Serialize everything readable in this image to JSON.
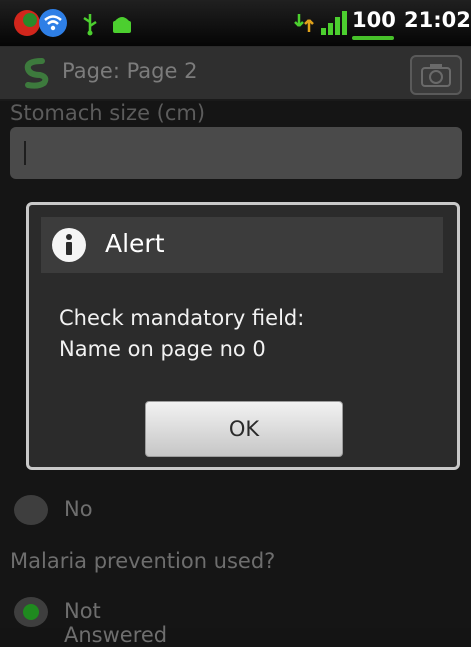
{
  "status_bar": {
    "battery": "100",
    "time": "21:02",
    "icons": [
      "app-notification-icon",
      "wifi-icon",
      "usb-icon",
      "android-debug-icon",
      "sync-icon",
      "signal-icon"
    ]
  },
  "title_bar": {
    "title": "Page: Page 2",
    "logo_icon": "app-logo-icon",
    "camera_icon": "camera-icon"
  },
  "form": {
    "top_label": "Stomach size (cm)",
    "text_value": "",
    "options_first": [
      {
        "label": "No",
        "selected": false
      }
    ],
    "question": "Malaria prevention used?",
    "options_second": [
      {
        "label": "Not Answered",
        "selected": true
      }
    ]
  },
  "dialog": {
    "title": "Alert",
    "icon": "info-icon",
    "message_line1": "Check mandatory field:",
    "message_line2": "Name on page no 0",
    "ok_label": "OK"
  },
  "colors": {
    "accent_green": "#47c12a",
    "dialog_border": "#c9c9c9",
    "radio_selected": "#1f8a1f"
  }
}
